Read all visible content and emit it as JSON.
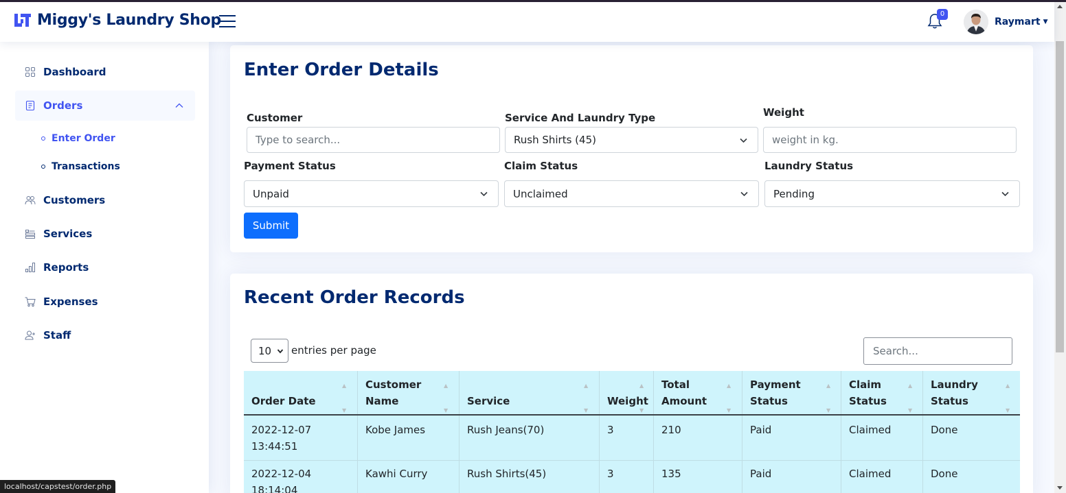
{
  "header": {
    "brand": "Miggy's Laundry Shop",
    "notification_count": "0",
    "user_name": "Raymart"
  },
  "sidebar": {
    "items": [
      {
        "label": "Dashboard",
        "icon": "grid-icon"
      },
      {
        "label": "Orders",
        "icon": "journal-icon"
      },
      {
        "label": "Customers",
        "icon": "people-icon"
      },
      {
        "label": "Services",
        "icon": "layers-icon"
      },
      {
        "label": "Reports",
        "icon": "bar-chart-icon"
      },
      {
        "label": "Expenses",
        "icon": "cart-icon"
      },
      {
        "label": "Staff",
        "icon": "person-add-icon"
      }
    ],
    "orders_sub": [
      {
        "label": "Enter Order"
      },
      {
        "label": "Transactions"
      }
    ]
  },
  "order_form": {
    "title": "Enter Order Details",
    "customer_label": "Customer",
    "customer_placeholder": "Type to search...",
    "service_label": "Service And Laundry Type",
    "service_value": "Rush Shirts (45)",
    "weight_label": "Weight",
    "weight_placeholder": "weight in kg.",
    "payment_label": "Payment Status",
    "payment_value": "Unpaid",
    "claim_label": "Claim Status",
    "claim_value": "Unclaimed",
    "laundry_label": "Laundry Status",
    "laundry_value": "Pending",
    "submit_label": "Submit"
  },
  "records": {
    "title": "Recent Order Records",
    "per_page_value": "10",
    "per_page_label": "entries per page",
    "search_placeholder": "Search...",
    "columns": [
      [
        "Order Date"
      ],
      [
        "Customer",
        "Name"
      ],
      [
        "Service"
      ],
      [
        "Weight"
      ],
      [
        "Total",
        "Amount"
      ],
      [
        "Payment",
        "Status"
      ],
      [
        "Claim",
        "Status"
      ],
      [
        "Laundry",
        "Status"
      ]
    ],
    "rows": [
      {
        "date": "2022-12-07",
        "time": "13:44:51",
        "customer": "Kobe James",
        "service": "Rush Jeans(70)",
        "weight": "3",
        "total": "210",
        "payment": "Paid",
        "claim": "Claimed",
        "laundry": "Done"
      },
      {
        "date": "2022-12-04",
        "time": "18:14:04",
        "customer": "Kawhi Curry",
        "service": "Rush Shirts(45)",
        "weight": "3",
        "total": "135",
        "payment": "Paid",
        "claim": "Claimed",
        "laundry": "Done"
      }
    ]
  },
  "status_url": "localhost/capstest/order.php",
  "colors": {
    "brand": "#012970",
    "accent": "#4154f1",
    "button": "#0d6efd",
    "table_bg": "#cff4fc"
  }
}
